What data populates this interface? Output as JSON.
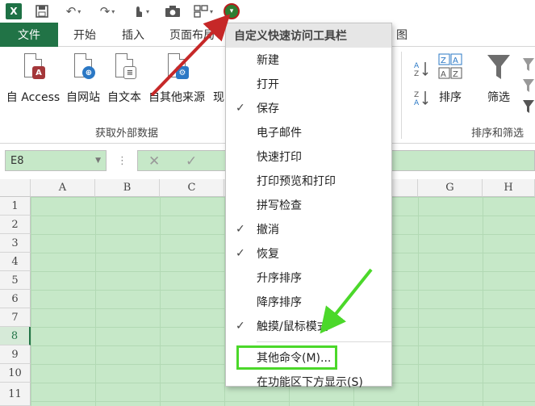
{
  "qat": {
    "logo": "X",
    "icons": [
      "excel-logo",
      "save-icon",
      "undo-icon",
      "redo-icon",
      "touch-mode-icon",
      "camera-icon",
      "form-icon",
      "customize-qat-icon"
    ]
  },
  "tabs": [
    "文件",
    "开始",
    "插入",
    "页面布局",
    "图"
  ],
  "ribbon": {
    "buttons": [
      "自 Access",
      "自网站",
      "自文本",
      "自其他来源",
      "现"
    ],
    "group_get_data": "获取外部数据",
    "sort_label": "排序",
    "filter_label": "筛选",
    "group_sort": "排序和筛选"
  },
  "formula_bar": {
    "name_box": "E8",
    "dots": "⋮",
    "cancel": "✕",
    "enter": "✓"
  },
  "grid": {
    "columns": [
      "A",
      "B",
      "C",
      "G",
      "H"
    ],
    "rows": [
      "1",
      "2",
      "3",
      "4",
      "5",
      "6",
      "7",
      "8",
      "9",
      "10",
      "11"
    ],
    "active_row": "8"
  },
  "menu": {
    "title": "自定义快速访问工具栏",
    "items": [
      {
        "label": "新建",
        "checked": false
      },
      {
        "label": "打开",
        "checked": false
      },
      {
        "label": "保存",
        "checked": true
      },
      {
        "label": "电子邮件",
        "checked": false
      },
      {
        "label": "快速打印",
        "checked": false
      },
      {
        "label": "打印预览和打印",
        "checked": false
      },
      {
        "label": "拼写检查",
        "checked": false
      },
      {
        "label": "撤消",
        "checked": true
      },
      {
        "label": "恢复",
        "checked": true
      },
      {
        "label": "升序排序",
        "checked": false
      },
      {
        "label": "降序排序",
        "checked": false
      },
      {
        "label": "触摸/鼠标模式",
        "checked": true
      }
    ],
    "more_commands": "其他命令(M)...",
    "show_below": "在功能区下方显示(S)",
    "check_glyph": "✓"
  },
  "colors": {
    "excel_green": "#217346",
    "cell_fill": "#c6e8c8",
    "highlight": "#4bd82a",
    "arrow_red": "#c62828"
  }
}
